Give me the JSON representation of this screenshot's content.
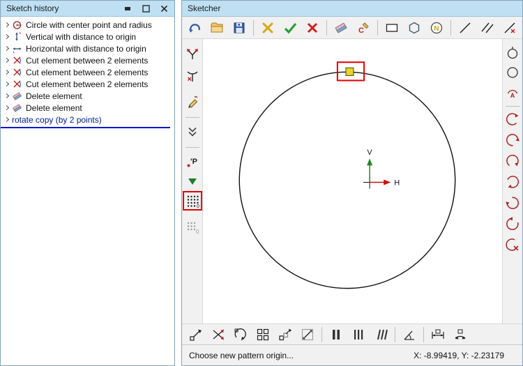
{
  "sketch_history": {
    "title": "Sketch history",
    "window_icons": [
      "minimize-icon",
      "maximize-icon",
      "close-icon"
    ],
    "items": [
      {
        "icon": "circle-radius-icon",
        "label": "Circle with center point and radius"
      },
      {
        "icon": "vertical-distance-icon",
        "label": "Vertical with distance to origin"
      },
      {
        "icon": "horizontal-distance-icon",
        "label": "Horizontal with distance to origin"
      },
      {
        "icon": "cut-element-icon",
        "label": "Cut element between 2 elements"
      },
      {
        "icon": "cut-element-icon",
        "label": "Cut element between 2 elements"
      },
      {
        "icon": "cut-element-icon",
        "label": "Cut element between 2 elements"
      },
      {
        "icon": "delete-element-icon",
        "label": "Delete element"
      },
      {
        "icon": "delete-element-icon",
        "label": "Delete element"
      },
      {
        "icon": "none",
        "label": "rotate copy (by 2 points)",
        "active": true
      }
    ]
  },
  "sketcher": {
    "title": "Sketcher",
    "top_toolbar_icons": [
      "undo-icon",
      "open-folder-icon",
      "save-icon",
      "delete-elements-icon",
      "accept-icon",
      "cancel-icon",
      "eraser-icon",
      "change-style-icon",
      "rectangle-tool-icon",
      "polygon-tool-icon",
      "point-number-icon",
      "line-tool-icon",
      "parallel-lines-icon",
      "construction-line-icon"
    ],
    "left_toolbar_icons": [
      "trim-intersection-icon",
      "trim-two-elements-icon",
      "modify-element-icon",
      "collapse-chevrons-icon",
      "pattern-origin-icon",
      "insert-pattern-icon",
      "rectangular-pattern-icon",
      "pattern-zero-icon"
    ],
    "right_toolbar_icons": [
      "circle-tangent-icon",
      "circle-icon",
      "arc-angle-icon",
      "arc-ccw-icon",
      "arc-rotated-40-icon",
      "arc-rotated-80-icon",
      "arc-rotated-160-icon",
      "arc-rotated-220-icon",
      "arc-rotated-300-icon",
      "arc-delete-icon"
    ],
    "bottom_toolbar_icons": [
      "move-origin-icon",
      "mirror-pattern-icon",
      "rotate-copy-icon",
      "rectangular-array-icon",
      "translate-array-icon",
      "scale-pattern-icon",
      "spacing-two-icon",
      "spacing-three-icon",
      "spacing-slant-icon",
      "angular-spacing-icon",
      "linear-dimension-icon",
      "arc-dimension-icon"
    ],
    "canvas": {
      "v_axis_label": "V",
      "h_axis_label": "H"
    },
    "glyphs": {
      "n": "N",
      "a": "A",
      "p": "'P",
      "zero": "0",
      "c": "C"
    },
    "status": {
      "message": "Choose new pattern origin...",
      "coordinates": "X: -8.99419, Y: -2.23179"
    }
  }
}
